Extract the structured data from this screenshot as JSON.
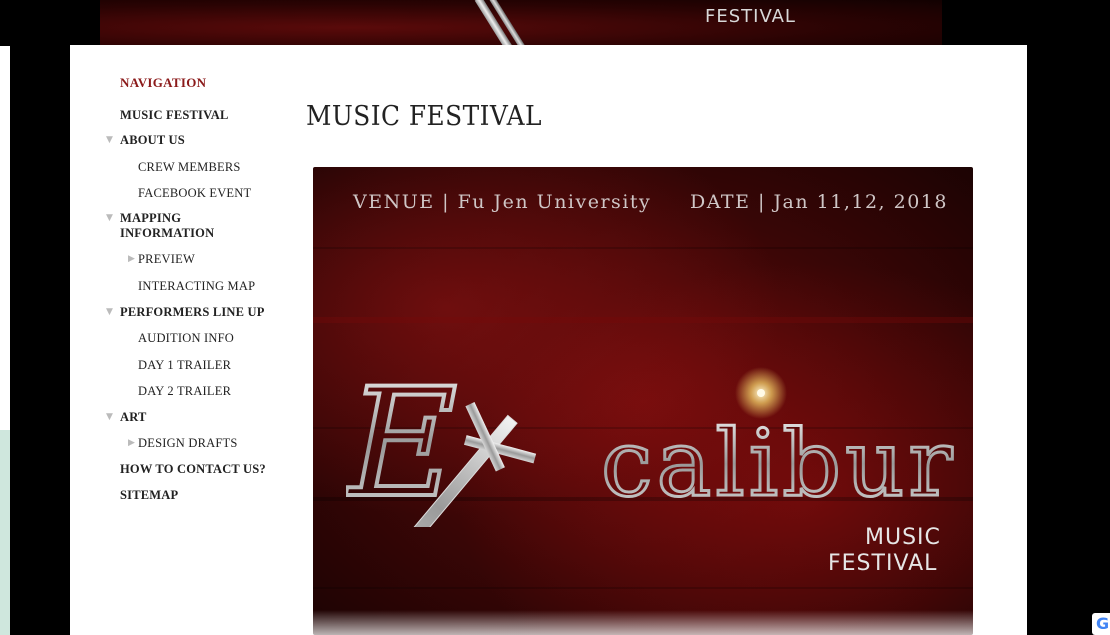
{
  "banner": {
    "festival_text": "FESTIVAL"
  },
  "navigation": {
    "heading": "NAVIGATION",
    "items": [
      {
        "label": "MUSIC FESTIVAL",
        "level": 0,
        "toggle": ""
      },
      {
        "label": "ABOUT US",
        "level": 0,
        "toggle": "expanded"
      },
      {
        "label": "CREW MEMBERS",
        "level": 1,
        "toggle": ""
      },
      {
        "label": "FACEBOOK EVENT",
        "level": 1,
        "toggle": ""
      },
      {
        "label": "MAPPING",
        "label2": "INFORMATION",
        "level": 0,
        "toggle": "expanded"
      },
      {
        "label": "PREVIEW",
        "level": 1,
        "toggle": "collapsed"
      },
      {
        "label": "INTERACTING MAP",
        "level": 1,
        "toggle": ""
      },
      {
        "label": "PERFORMERS LINE UP",
        "level": 0,
        "toggle": "expanded"
      },
      {
        "label": "AUDITION INFO",
        "level": 1,
        "toggle": ""
      },
      {
        "label": "DAY 1 TRAILER",
        "level": 1,
        "toggle": ""
      },
      {
        "label": "DAY 2 TRAILER",
        "level": 1,
        "toggle": ""
      },
      {
        "label": "ART",
        "level": 0,
        "toggle": "expanded"
      },
      {
        "label": "DESIGN DRAFTS",
        "level": 1,
        "toggle": "collapsed"
      },
      {
        "label": "HOW TO CONTACT US?",
        "level": 0,
        "toggle": ""
      },
      {
        "label": "SITEMAP",
        "level": 0,
        "toggle": ""
      }
    ]
  },
  "page": {
    "title": "MUSIC FESTIVAL"
  },
  "poster": {
    "venue": "VENUE | Fu Jen University",
    "date": "DATE | Jan 11,12, 2018",
    "logo_text": "Excalibur",
    "sub_line1": "MUSIC",
    "sub_line2": "FESTIVAL"
  },
  "widgets": {
    "google_icon": "google-g-icon",
    "google_glyph": "G"
  },
  "colors": {
    "nav_heading": "#8b1a1a",
    "poster_red": "#6a0c0c",
    "toggle_gray": "#bbbbbb"
  }
}
